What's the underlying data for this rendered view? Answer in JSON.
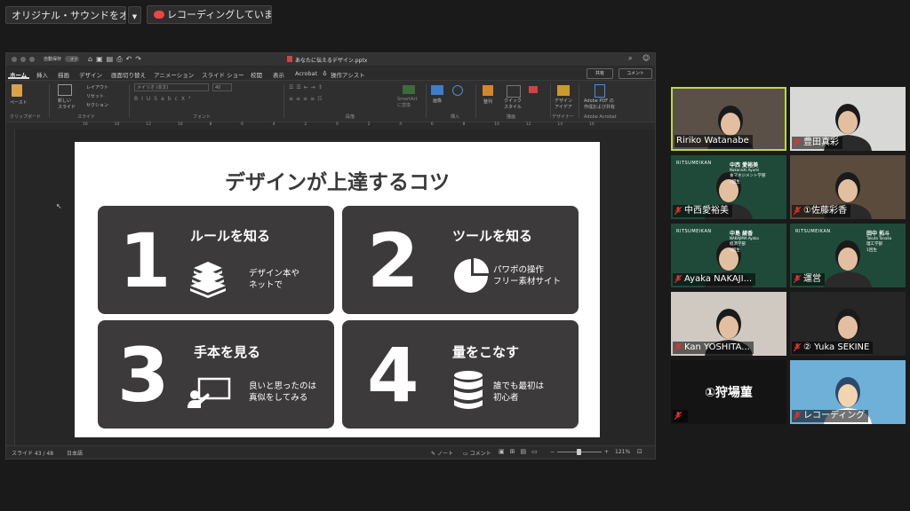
{
  "topbar": {
    "sound_button": "オリジナル・サウンドをオンにする",
    "recording": "レコーディングしています..."
  },
  "ppt": {
    "autosave": "自動保存",
    "autosave_toggle": "オフ",
    "file_title": "あなたに伝えるデザイン.pptx",
    "menu_tabs": [
      "ホーム",
      "挿入",
      "描画",
      "デザイン",
      "画面切り替え",
      "アニメーション",
      "スライド ショー",
      "校閲",
      "表示",
      "Acrobat"
    ],
    "assist": "操作アシスト",
    "share": "共有",
    "comment": "コメント",
    "ribbon": {
      "paste": "ペースト",
      "clipboard": "クリップボード",
      "new_slide": "新しい\nスライド",
      "layout": "レイアウト",
      "reset": "リセット",
      "section": "セクション",
      "slides_group": "スライド",
      "font_name": "メイリオ (本文)",
      "font_size": "40",
      "font_group": "フォント",
      "paragraph_group": "段落",
      "smartart": "SmartArt\nに変換",
      "image": "画像",
      "insert_group": "挿入",
      "arrange": "整列",
      "quick_style": "クイック\nスタイル",
      "draw_group": "描画",
      "design_idea": "デザイン\nアイデア",
      "designer_group": "デザイナー",
      "adobe": "Adobe PDF の\n作成および共有",
      "adobe_group": "Adobe Acrobat"
    },
    "ruler_numbers": [
      "16",
      "14",
      "12",
      "10",
      "8",
      "6",
      "4",
      "2",
      "0",
      "2",
      "4",
      "6",
      "8",
      "10",
      "12",
      "14",
      "16"
    ],
    "status": {
      "slide": "スライド 43 / 48",
      "lang": "日本語",
      "notes": "ノート",
      "comments": "コメント",
      "zoom": "121%"
    }
  },
  "slide": {
    "title": "デザインが上達するコツ",
    "cards": [
      {
        "num": "1",
        "title": "ルールを知る",
        "desc": "デザイン本や\nネットで",
        "icon": "books-icon"
      },
      {
        "num": "2",
        "title": "ツールを知る",
        "desc": "パワポの操作\nフリー素材サイト",
        "icon": "pie-chart-icon"
      },
      {
        "num": "3",
        "title": "手本を見る",
        "desc": "良いと思ったのは\n真似をしてみる",
        "icon": "presenter-icon"
      },
      {
        "num": "4",
        "title": "量をこなす",
        "desc": "誰でも最初は\n初心者",
        "icon": "database-icon"
      }
    ]
  },
  "participants": [
    {
      "name": "Ririko Watanabe",
      "muted": false,
      "active": true
    },
    {
      "name": "豊田真彩",
      "muted": true
    },
    {
      "name": "中西愛裕美",
      "muted": true,
      "card_school": "RITSUMEIKAN",
      "card_name": "中西 愛裕美",
      "card_sub": "Nakanishi Ayumi",
      "card_dept": "食マネジメント学部",
      "card_year": "2回生"
    },
    {
      "name": "①佐藤彩香",
      "muted": true
    },
    {
      "name": "Ayaka NAKAJI...",
      "muted": true,
      "card_school": "RITSUMEIKAN",
      "card_name": "中島 綾香",
      "card_sub": "NAKAJIMA Ayaka",
      "card_dept": "経済学部",
      "card_year": "3回生"
    },
    {
      "name": "運営",
      "muted": true,
      "card_school": "RITSUMEIKAN",
      "card_name": "田中 拓斗",
      "card_sub": "Takuto Tanaka",
      "card_dept": "理工学部",
      "card_year": "1回生"
    },
    {
      "name": "Kan YOSHITA...",
      "muted": true
    },
    {
      "name": "② Yuka SEKINE",
      "muted": true
    },
    {
      "name": "",
      "muted": true,
      "center_text": "①狩場菫"
    },
    {
      "name": "レコーディング",
      "muted": true
    }
  ],
  "colors": {
    "accent_green": "#b9d847",
    "mute_red": "#e0312f",
    "card_dark": "#3d3a3b"
  }
}
